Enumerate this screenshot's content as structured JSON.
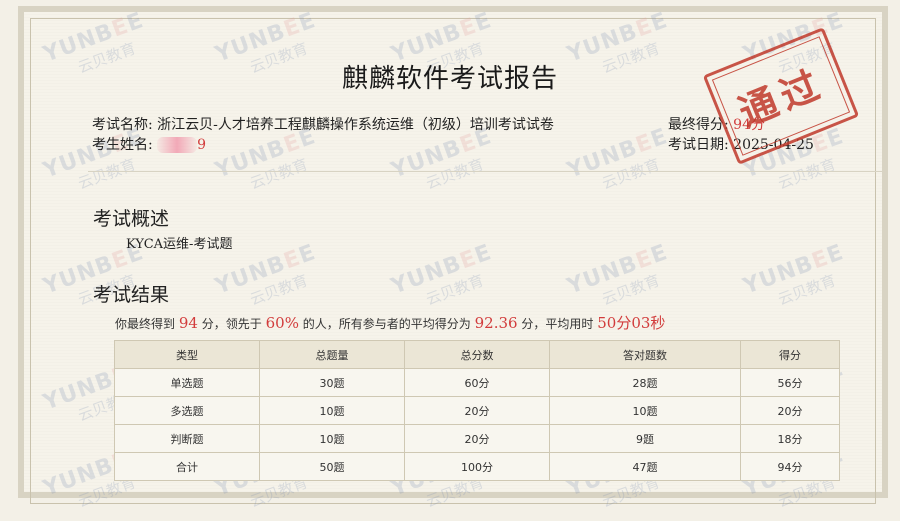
{
  "watermark": {
    "en_left": "YUNB",
    "en_mid": "E",
    "en_right": "E",
    "cn": "云贝教育"
  },
  "title": "麒麟软件考试报告",
  "exam": {
    "name_label": "考试名称:",
    "name_value": "浙江云贝-人才培养工程麒麟操作系统运维（初级）培训考试试卷",
    "candidate_label": "考生姓名:",
    "candidate_value": "9",
    "score_label": "最终得分:",
    "score_value": "94分",
    "date_label": "考试日期:",
    "date_value": "2025-04-25"
  },
  "stamp": {
    "text": "通过"
  },
  "overview": {
    "heading": "考试概述",
    "text": "KYCA运维-考试题"
  },
  "result": {
    "heading": "考试结果",
    "s1": "你最终得到",
    "score": "94",
    "s2": "分，领先于",
    "percent": "60%",
    "s3": "的人，所有参与者的平均得分为",
    "avg": "92.36",
    "s4": "分，平均用时",
    "time": "50分03秒"
  },
  "table": {
    "headers": [
      "类型",
      "总题量",
      "总分数",
      "答对题数",
      "得分"
    ],
    "rows": [
      [
        "单选题",
        "30题",
        "60分",
        "28题",
        "56分"
      ],
      [
        "多选题",
        "10题",
        "20分",
        "10题",
        "20分"
      ],
      [
        "判断题",
        "10题",
        "20分",
        "9题",
        "18分"
      ],
      [
        "合计",
        "50题",
        "100分",
        "47题",
        "94分"
      ]
    ]
  }
}
